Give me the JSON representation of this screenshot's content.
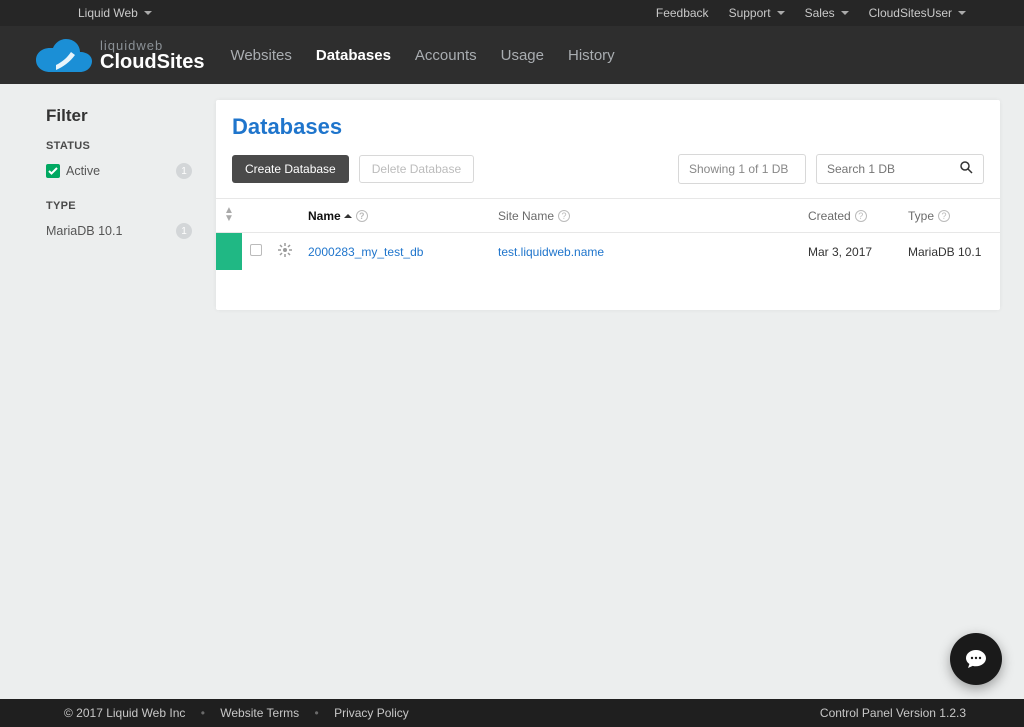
{
  "utilbar": {
    "brand": "Liquid Web",
    "feedback": "Feedback",
    "support": "Support",
    "sales": "Sales",
    "user": "CloudSitesUser"
  },
  "logo": {
    "line1": "liquidweb",
    "line2": "CloudSites"
  },
  "nav": {
    "websites": "Websites",
    "databases": "Databases",
    "accounts": "Accounts",
    "usage": "Usage",
    "history": "History"
  },
  "sidebar": {
    "title": "Filter",
    "status_label": "STATUS",
    "status_items": [
      {
        "label": "Active",
        "count": "1",
        "checked": true
      }
    ],
    "type_label": "TYPE",
    "type_items": [
      {
        "label": "MariaDB 10.1",
        "count": "1"
      }
    ]
  },
  "page": {
    "title": "Databases",
    "create_btn": "Create Database",
    "delete_btn": "Delete Database",
    "showing": "Showing 1 of 1 DB",
    "search_placeholder": "Search 1 DB"
  },
  "table": {
    "cols": {
      "name": "Name",
      "site": "Site Name",
      "created": "Created",
      "type": "Type"
    },
    "rows": [
      {
        "name": "2000283_my_test_db",
        "site": "test.liquidweb.name",
        "created": "Mar 3, 2017",
        "type": "MariaDB 10.1"
      }
    ]
  },
  "footer": {
    "copyright": "© 2017 Liquid Web Inc",
    "terms": "Website Terms",
    "privacy": "Privacy Policy",
    "version": "Control Panel Version 1.2.3"
  }
}
